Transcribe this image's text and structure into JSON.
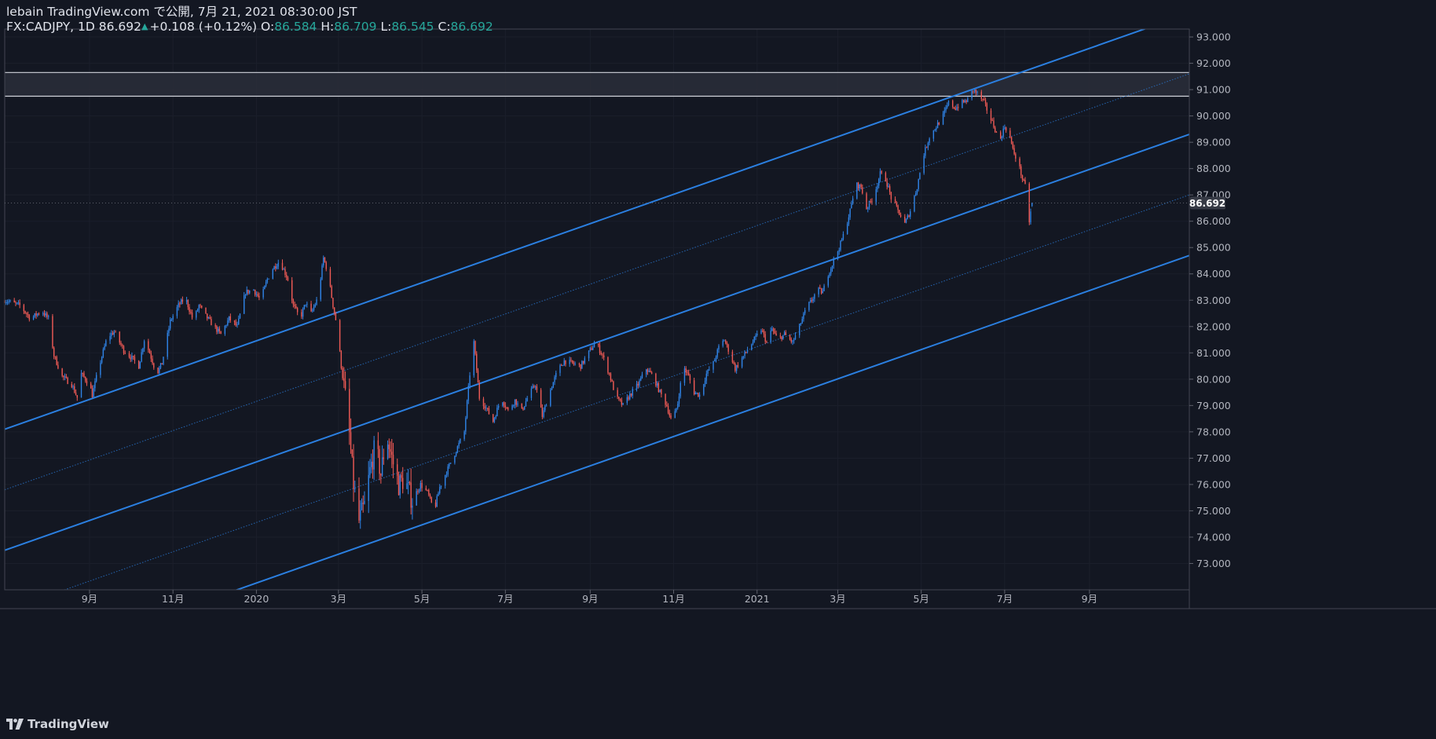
{
  "header": {
    "publisher_line": "lebain TradingView.com で公開, 7月 21, 2021 08:30:00 JST",
    "symbol_line": "FX:CADJPY, 1D",
    "last_price": "86.692",
    "change": "+0.108 (+0.12%)",
    "open_label": "O:",
    "open": "86.584",
    "high_label": "H:",
    "high": "86.709",
    "low_label": "L:",
    "low": "86.545",
    "close_label": "C:",
    "close": "86.692"
  },
  "logo_text": "TradingView",
  "colors": {
    "background": "#131722",
    "up_candle": "#2f83e6",
    "down_candle": "#ef5a55",
    "channel": "#2b7fe0",
    "zone": "#2a2e39",
    "zone_line": "#d1d4dc",
    "price_label_bg": "#363a45"
  },
  "chart_data": {
    "type": "candlestick",
    "symbol": "FX:CADJPY",
    "interval": "1D",
    "y_axis": {
      "ticks": [
        73,
        74,
        75,
        76,
        77,
        78,
        79,
        80,
        81,
        82,
        83,
        84,
        85,
        86,
        87,
        88,
        89,
        90,
        91,
        92,
        93
      ],
      "range": [
        72.0,
        93.3
      ],
      "side": "right",
      "decimals": 3
    },
    "x_axis": {
      "start": "2019-07-01",
      "end": "2021-11-13",
      "ticks": [
        {
          "date": "2019-09-01",
          "label": "9月"
        },
        {
          "date": "2019-11-01",
          "label": "11月"
        },
        {
          "date": "2020-01-01",
          "label": "2020"
        },
        {
          "date": "2020-03-01",
          "label": "3月"
        },
        {
          "date": "2020-05-01",
          "label": "5月"
        },
        {
          "date": "2020-07-01",
          "label": "7月"
        },
        {
          "date": "2020-09-01",
          "label": "9月"
        },
        {
          "date": "2020-11-01",
          "label": "11月"
        },
        {
          "date": "2021-01-01",
          "label": "2021"
        },
        {
          "date": "2021-03-01",
          "label": "3月"
        },
        {
          "date": "2021-05-01",
          "label": "5月"
        },
        {
          "date": "2021-07-01",
          "label": "7月"
        },
        {
          "date": "2021-09-01",
          "label": "9月"
        }
      ]
    },
    "last_price_label": "86.692",
    "last_price": 86.692,
    "price_path": [
      [
        "2019-07-01",
        83.0
      ],
      [
        "2019-07-12",
        82.8
      ],
      [
        "2019-07-20",
        82.3
      ],
      [
        "2019-07-28",
        82.6
      ],
      [
        "2019-08-02",
        82.3
      ],
      [
        "2019-08-06",
        80.9
      ],
      [
        "2019-08-12",
        80.1
      ],
      [
        "2019-08-19",
        79.8
      ],
      [
        "2019-08-23",
        79.3
      ],
      [
        "2019-08-26",
        80.2
      ],
      [
        "2019-09-01",
        79.8
      ],
      [
        "2019-09-03",
        79.4
      ],
      [
        "2019-09-08",
        80.5
      ],
      [
        "2019-09-14",
        81.6
      ],
      [
        "2019-09-19",
        81.8
      ],
      [
        "2019-09-26",
        81.1
      ],
      [
        "2019-10-02",
        80.8
      ],
      [
        "2019-10-07",
        80.5
      ],
      [
        "2019-10-11",
        81.5
      ],
      [
        "2019-10-15",
        81.0
      ],
      [
        "2019-10-20",
        80.2
      ],
      [
        "2019-10-24",
        80.6
      ],
      [
        "2019-10-30",
        82.2
      ],
      [
        "2019-11-05",
        82.8
      ],
      [
        "2019-11-10",
        83.1
      ],
      [
        "2019-11-16",
        82.2
      ],
      [
        "2019-11-20",
        82.8
      ],
      [
        "2019-11-25",
        82.4
      ],
      [
        "2019-12-01",
        82.0
      ],
      [
        "2019-12-06",
        81.7
      ],
      [
        "2019-12-12",
        82.3
      ],
      [
        "2019-12-18",
        82.0
      ],
      [
        "2019-12-24",
        83.3
      ],
      [
        "2019-12-30",
        83.4
      ],
      [
        "2020-01-04",
        83.0
      ],
      [
        "2020-01-09",
        83.8
      ],
      [
        "2020-01-13",
        84.2
      ],
      [
        "2020-01-18",
        84.5
      ],
      [
        "2020-01-24",
        83.8
      ],
      [
        "2020-01-28",
        82.8
      ],
      [
        "2020-02-02",
        82.3
      ],
      [
        "2020-02-06",
        82.9
      ],
      [
        "2020-02-10",
        82.5
      ],
      [
        "2020-02-15",
        83.1
      ],
      [
        "2020-02-19",
        84.6
      ],
      [
        "2020-02-22",
        84.1
      ],
      [
        "2020-02-26",
        82.8
      ],
      [
        "2020-02-29",
        82.0
      ],
      [
        "2020-03-03",
        80.5
      ],
      [
        "2020-03-08",
        78.5
      ],
      [
        "2020-03-12",
        76.0
      ],
      [
        "2020-03-16",
        74.6
      ],
      [
        "2020-03-20",
        75.2
      ],
      [
        "2020-03-24",
        76.5
      ],
      [
        "2020-03-28",
        77.5
      ],
      [
        "2020-04-01",
        76.4
      ],
      [
        "2020-04-05",
        77.9
      ],
      [
        "2020-04-10",
        76.8
      ],
      [
        "2020-04-14",
        76.0
      ],
      [
        "2020-04-18",
        76.2
      ],
      [
        "2020-04-24",
        75.4
      ],
      [
        "2020-04-30",
        76.0
      ],
      [
        "2020-05-05",
        75.7
      ],
      [
        "2020-05-10",
        75.0
      ],
      [
        "2020-05-14",
        75.9
      ],
      [
        "2020-05-20",
        76.6
      ],
      [
        "2020-05-26",
        77.3
      ],
      [
        "2020-06-01",
        78.0
      ],
      [
        "2020-06-05",
        80.2
      ],
      [
        "2020-06-08",
        81.4
      ],
      [
        "2020-06-12",
        79.3
      ],
      [
        "2020-06-16",
        79.0
      ],
      [
        "2020-06-22",
        78.4
      ],
      [
        "2020-06-28",
        79.3
      ],
      [
        "2020-07-03",
        78.8
      ],
      [
        "2020-07-08",
        79.2
      ],
      [
        "2020-07-13",
        78.8
      ],
      [
        "2020-07-18",
        79.4
      ],
      [
        "2020-07-23",
        79.8
      ],
      [
        "2020-07-28",
        78.6
      ],
      [
        "2020-08-03",
        79.6
      ],
      [
        "2020-08-08",
        80.3
      ],
      [
        "2020-08-13",
        80.7
      ],
      [
        "2020-08-19",
        80.6
      ],
      [
        "2020-08-25",
        80.5
      ],
      [
        "2020-09-01",
        81.1
      ],
      [
        "2020-09-05",
        81.4
      ],
      [
        "2020-09-10",
        80.9
      ],
      [
        "2020-09-15",
        80.2
      ],
      [
        "2020-09-20",
        79.3
      ],
      [
        "2020-09-25",
        79.0
      ],
      [
        "2020-09-30",
        79.4
      ],
      [
        "2020-10-06",
        79.8
      ],
      [
        "2020-10-12",
        80.4
      ],
      [
        "2020-10-17",
        80.1
      ],
      [
        "2020-10-22",
        79.5
      ],
      [
        "2020-10-27",
        79.0
      ],
      [
        "2020-10-31",
        78.3
      ],
      [
        "2020-11-04",
        79.1
      ],
      [
        "2020-11-08",
        80.5
      ],
      [
        "2020-11-12",
        80.1
      ],
      [
        "2020-11-16",
        79.5
      ],
      [
        "2020-11-20",
        79.4
      ],
      [
        "2020-11-25",
        80.2
      ],
      [
        "2020-11-30",
        80.6
      ],
      [
        "2020-12-04",
        81.2
      ],
      [
        "2020-12-08",
        81.5
      ],
      [
        "2020-12-12",
        81.0
      ],
      [
        "2020-12-16",
        80.4
      ],
      [
        "2020-12-20",
        80.7
      ],
      [
        "2020-12-26",
        81.2
      ],
      [
        "2020-12-30",
        81.5
      ],
      [
        "2021-01-04",
        81.9
      ],
      [
        "2021-01-08",
        81.4
      ],
      [
        "2021-01-12",
        81.9
      ],
      [
        "2021-01-16",
        81.5
      ],
      [
        "2021-01-21",
        81.7
      ],
      [
        "2021-01-27",
        81.4
      ],
      [
        "2021-02-01",
        82.0
      ],
      [
        "2021-02-06",
        82.7
      ],
      [
        "2021-02-10",
        83.0
      ],
      [
        "2021-02-14",
        83.4
      ],
      [
        "2021-02-18",
        83.3
      ],
      [
        "2021-02-22",
        84.0
      ],
      [
        "2021-02-26",
        84.5
      ],
      [
        "2021-03-02",
        85.0
      ],
      [
        "2021-03-06",
        85.6
      ],
      [
        "2021-03-10",
        86.4
      ],
      [
        "2021-03-14",
        87.4
      ],
      [
        "2021-03-18",
        87.3
      ],
      [
        "2021-03-22",
        86.5
      ],
      [
        "2021-03-27",
        86.9
      ],
      [
        "2021-04-01",
        87.8
      ],
      [
        "2021-04-05",
        87.6
      ],
      [
        "2021-04-09",
        86.9
      ],
      [
        "2021-04-14",
        86.4
      ],
      [
        "2021-04-19",
        85.9
      ],
      [
        "2021-04-23",
        86.4
      ],
      [
        "2021-04-28",
        87.3
      ],
      [
        "2021-05-02",
        88.4
      ],
      [
        "2021-05-07",
        89.2
      ],
      [
        "2021-05-12",
        89.6
      ],
      [
        "2021-05-17",
        90.0
      ],
      [
        "2021-05-21",
        90.5
      ],
      [
        "2021-05-26",
        90.3
      ],
      [
        "2021-05-31",
        90.5
      ],
      [
        "2021-06-04",
        90.6
      ],
      [
        "2021-06-08",
        91.0
      ],
      [
        "2021-06-12",
        90.8
      ],
      [
        "2021-06-16",
        90.5
      ],
      [
        "2021-06-20",
        90.0
      ],
      [
        "2021-06-24",
        89.5
      ],
      [
        "2021-06-27",
        89.0
      ],
      [
        "2021-07-01",
        89.6
      ],
      [
        "2021-07-04",
        89.4
      ],
      [
        "2021-07-07",
        88.7
      ],
      [
        "2021-07-11",
        88.2
      ],
      [
        "2021-07-14",
        87.6
      ],
      [
        "2021-07-17",
        87.2
      ],
      [
        "2021-07-19",
        86.0
      ],
      [
        "2021-07-21",
        86.69
      ]
    ],
    "channels": [
      {
        "style": "solid",
        "p1": [
          "2019-07-01",
          78.1
        ],
        "p2": [
          "2021-11-13",
          93.9
        ]
      },
      {
        "style": "dotted",
        "p1": [
          "2019-07-01",
          75.8
        ],
        "p2": [
          "2021-11-13",
          91.6
        ]
      },
      {
        "style": "solid",
        "p1": [
          "2019-07-01",
          73.5
        ],
        "p2": [
          "2021-11-13",
          89.3
        ]
      },
      {
        "style": "dotted",
        "p1": [
          "2019-07-01",
          71.2
        ],
        "p2": [
          "2021-11-13",
          87.0
        ]
      },
      {
        "style": "solid",
        "p1": [
          "2019-07-01",
          68.9
        ],
        "p2": [
          "2021-11-13",
          84.7
        ]
      }
    ],
    "resistance_zone": {
      "top": 91.65,
      "bottom": 90.75
    }
  }
}
